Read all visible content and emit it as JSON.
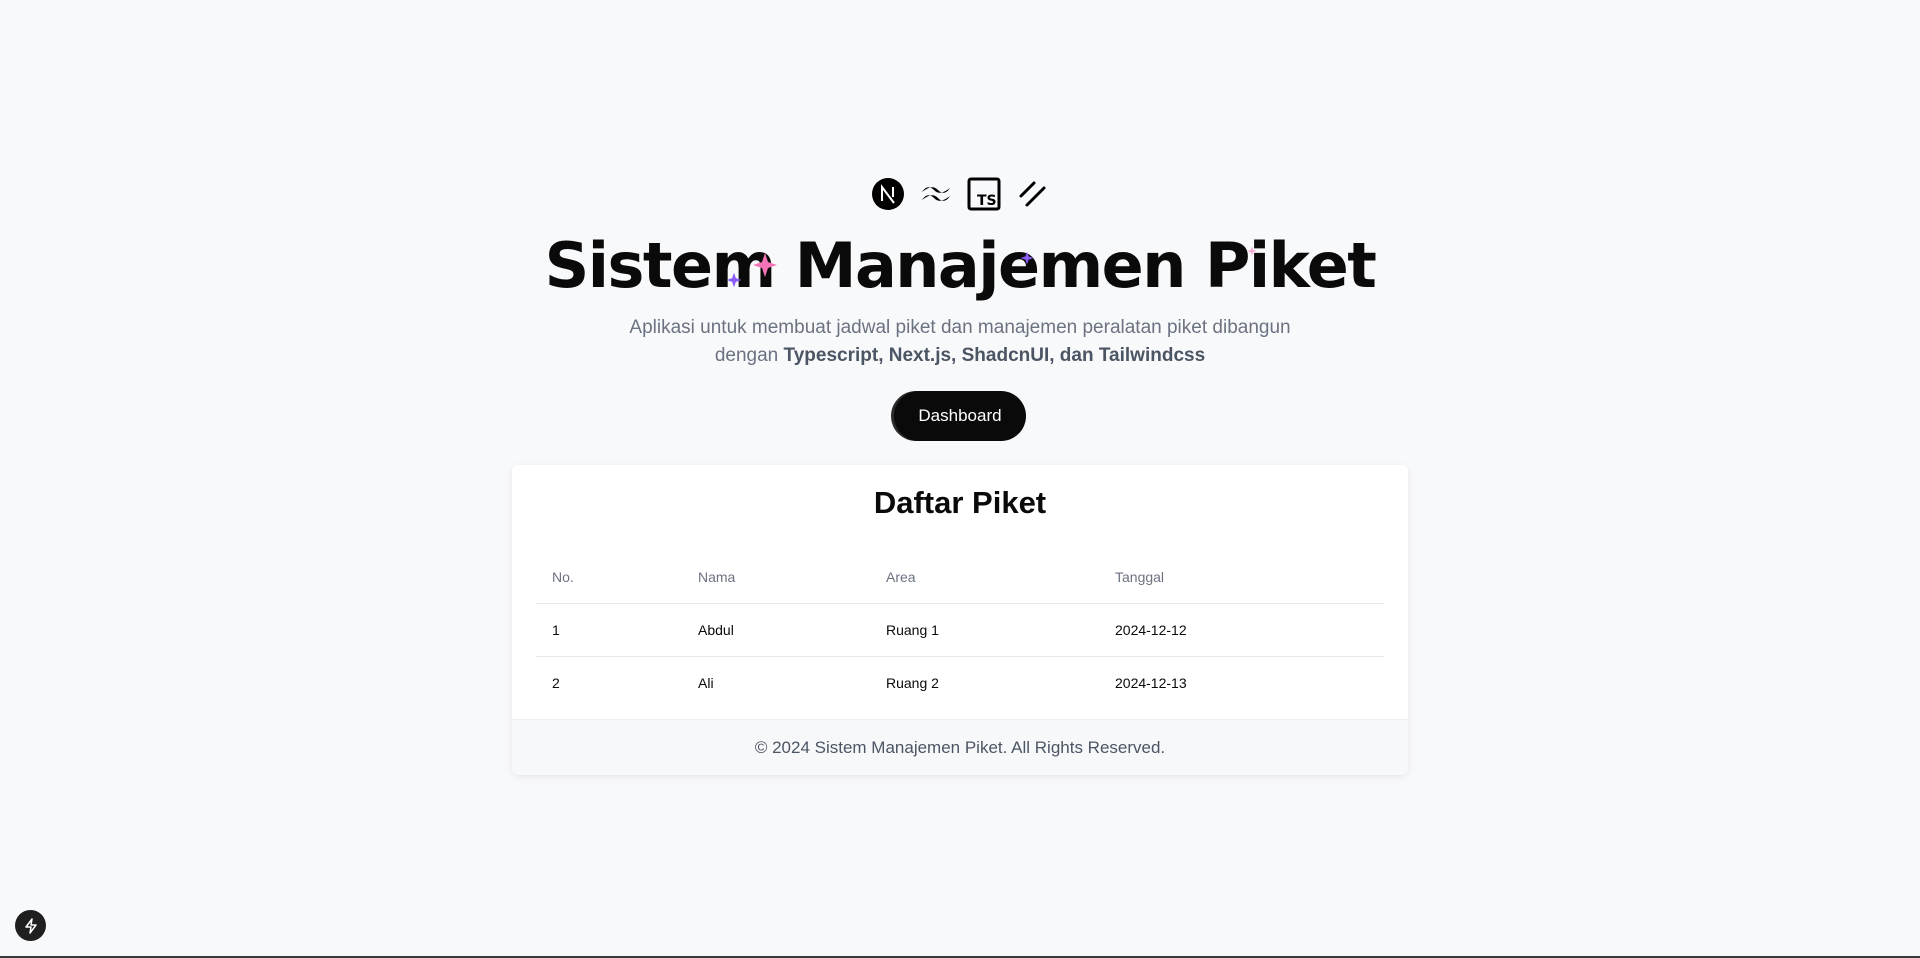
{
  "hero": {
    "icons": [
      "nextjs-icon",
      "tailwind-icon",
      "typescript-icon",
      "shadcn-icon"
    ],
    "title": "Sistem Manajemen Piket",
    "subtitle_prefix": "Aplikasi untuk membuat jadwal piket dan manajemen peralatan piket dibangun dengan ",
    "subtitle_bold": "Typescript, Next.js, ShadcnUI, dan Tailwindcss",
    "button_label": "Dashboard"
  },
  "card": {
    "title": "Daftar Piket",
    "columns": [
      "No.",
      "Nama",
      "Area",
      "Tanggal"
    ],
    "rows": [
      [
        "1",
        "Abdul",
        "Ruang 1",
        "2024-12-12"
      ],
      [
        "2",
        "Ali",
        "Ruang 2",
        "2024-12-13"
      ]
    ],
    "footer": "© 2024 Sistem Manajemen Piket. All Rights Reserved."
  },
  "colors": {
    "background": "#f8f9fb",
    "primary": "#0a0a0a",
    "muted_text": "#6b7280",
    "sparkle_pink": "#f472b6",
    "sparkle_purple": "#8b5cf6"
  },
  "corner_badge": {
    "icon": "lightning-icon"
  }
}
